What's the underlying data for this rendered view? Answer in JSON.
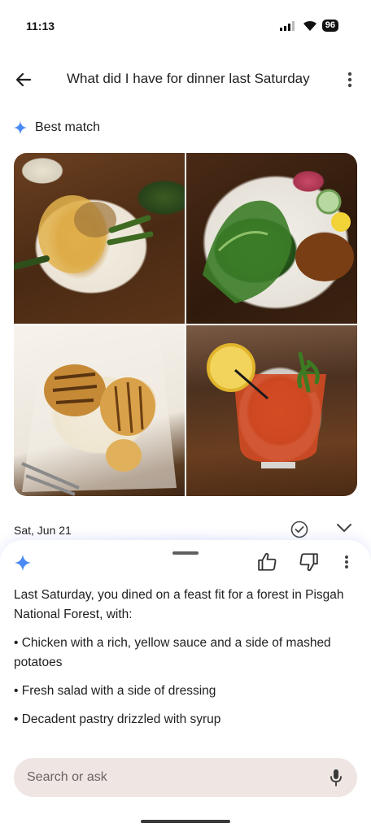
{
  "status_bar": {
    "time": "11:13",
    "battery": "96"
  },
  "app_bar": {
    "title": "What did I have for dinner last Saturday"
  },
  "best_match": {
    "label": "Best match"
  },
  "photos": [
    {
      "description_icon": "chicken-photo"
    },
    {
      "description_icon": "salad-photo"
    },
    {
      "description_icon": "pastry-photo"
    },
    {
      "description_icon": "cocktail-photo"
    }
  ],
  "date_row": {
    "date": "Sat, Jun 21"
  },
  "answer": {
    "intro": "Last Saturday, you dined on a feast fit for a forest in Pisgah National Forest, with:",
    "items": [
      "• Chicken with a rich, yellow sauce and a side of mashed potatoes",
      "• Fresh salad with a side of dressing",
      "• Decadent pastry drizzled with syrup"
    ]
  },
  "search": {
    "placeholder": "Search or ask"
  },
  "colors": {
    "accent": "#4a8af4",
    "search_bg": "#efe5e2"
  }
}
